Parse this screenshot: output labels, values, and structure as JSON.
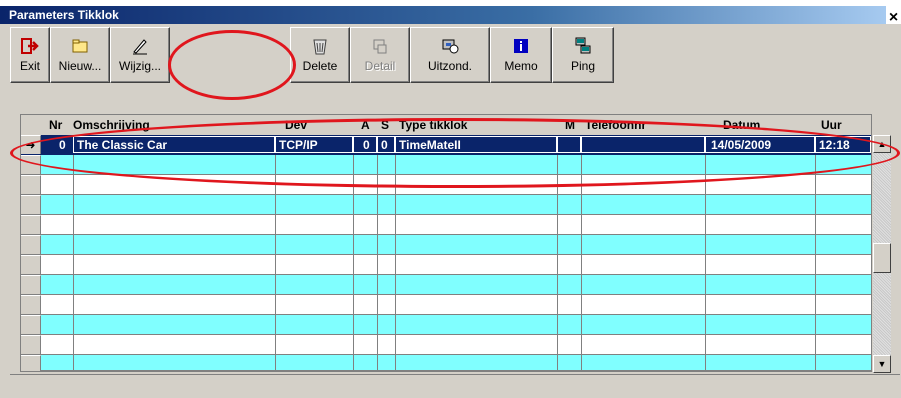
{
  "window": {
    "title": "Parameters Tikklok",
    "close_glyph": "×"
  },
  "toolbar": {
    "buttons": [
      {
        "label": "Exit",
        "icon": "exit-icon"
      },
      {
        "label": "Nieuw...",
        "icon": "new-icon"
      },
      {
        "label": "Wijzig...",
        "icon": "edit-icon"
      },
      {
        "label": "Delete",
        "icon": "trash-icon"
      },
      {
        "label": "Detail",
        "icon": "detail-icon",
        "disabled": true
      },
      {
        "label": "Uitzond.",
        "icon": "exceptions-icon"
      },
      {
        "label": "Memo",
        "icon": "info-icon"
      },
      {
        "label": "Ping",
        "icon": "network-icon"
      }
    ]
  },
  "grid": {
    "columns": [
      "Nr",
      "Omschrijving",
      "Dev",
      "A",
      "S",
      "Type tikklok",
      "M",
      "Telefoonnr",
      "Datum",
      "Uur"
    ],
    "rows": [
      {
        "nr": "0",
        "omschrijving": "The Classic Car",
        "dev": "TCP/IP",
        "a": "0",
        "s": "0",
        "type": "TimeMateII",
        "m": "",
        "telefoonnr": "",
        "datum": "14/05/2009",
        "uur": "12:18"
      }
    ],
    "current_row_glyph": "➜"
  },
  "colors": {
    "row_cyan": "#80ffff",
    "selection": "#0a246a",
    "annotation": "#e0161d"
  }
}
